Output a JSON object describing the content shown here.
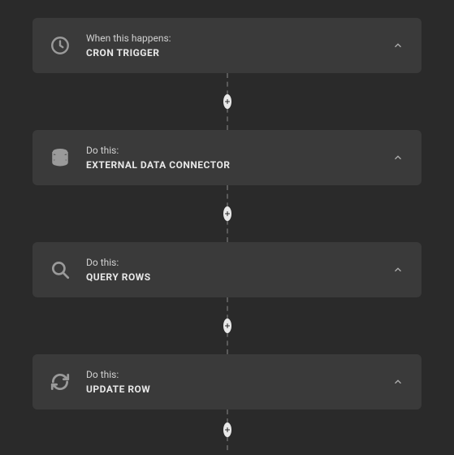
{
  "steps": [
    {
      "label": "When this happens:",
      "title": "CRON TRIGGER",
      "icon": "clock-icon"
    },
    {
      "label": "Do this:",
      "title": "EXTERNAL DATA CONNECTOR",
      "icon": "database-icon"
    },
    {
      "label": "Do this:",
      "title": "QUERY ROWS",
      "icon": "search-icon"
    },
    {
      "label": "Do this:",
      "title": "UPDATE ROW",
      "icon": "refresh-icon"
    }
  ],
  "colors": {
    "bg": "#2a2a2a",
    "card": "#3a3a3a",
    "icon": "#9a9a9a",
    "text": "#d0d0d0",
    "title": "#e8e8e8"
  }
}
